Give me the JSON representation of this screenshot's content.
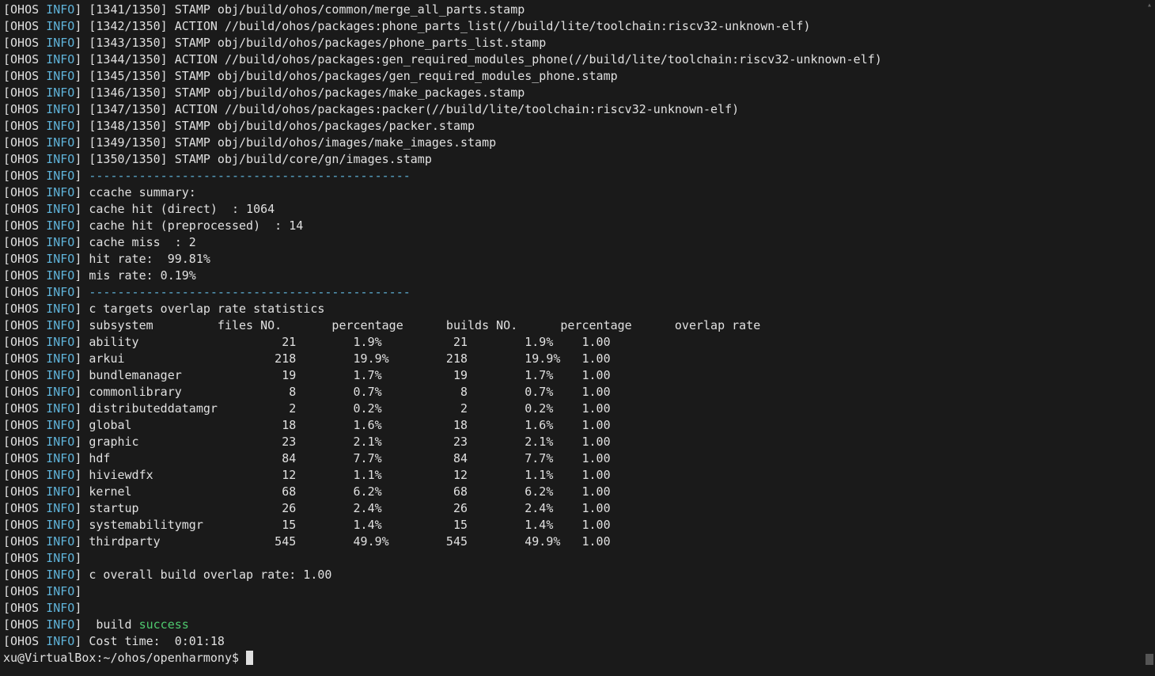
{
  "prefix_ohos": "OHOS",
  "prefix_info": "INFO",
  "build_lines": [
    {
      "counter": "[1341/1350]",
      "text": "STAMP obj/build/ohos/common/merge_all_parts.stamp"
    },
    {
      "counter": "[1342/1350]",
      "text": "ACTION //build/ohos/packages:phone_parts_list(//build/lite/toolchain:riscv32-unknown-elf)"
    },
    {
      "counter": "[1343/1350]",
      "text": "STAMP obj/build/ohos/packages/phone_parts_list.stamp"
    },
    {
      "counter": "[1344/1350]",
      "text": "ACTION //build/ohos/packages:gen_required_modules_phone(//build/lite/toolchain:riscv32-unknown-elf)"
    },
    {
      "counter": "[1345/1350]",
      "text": "STAMP obj/build/ohos/packages/gen_required_modules_phone.stamp"
    },
    {
      "counter": "[1346/1350]",
      "text": "STAMP obj/build/ohos/packages/make_packages.stamp"
    },
    {
      "counter": "[1347/1350]",
      "text": "ACTION //build/ohos/packages:packer(//build/lite/toolchain:riscv32-unknown-elf)"
    },
    {
      "counter": "[1348/1350]",
      "text": "STAMP obj/build/ohos/packages/packer.stamp"
    },
    {
      "counter": "[1349/1350]",
      "text": "STAMP obj/build/ohos/images/make_images.stamp"
    },
    {
      "counter": "[1350/1350]",
      "text": "STAMP obj/build/core/gn/images.stamp"
    }
  ],
  "divider": "---------------------------------------------",
  "ccache": {
    "summary_label": "ccache summary:",
    "hit_direct": "cache hit (direct)  : 1064",
    "hit_pre": "cache hit (preprocessed)  : 14",
    "miss": "cache miss  : 2",
    "hit_rate": "hit rate:  99.81%",
    "mis_rate": "mis rate: 0.19%"
  },
  "stats_title": "c targets overlap rate statistics",
  "stats_header": "subsystem         files NO.       percentage      builds NO.      percentage      overlap rate",
  "stats_rows": [
    {
      "subsystem": "ability",
      "files": 21,
      "fp": "1.9%",
      "builds": 21,
      "bp": "1.9%",
      "rate": "1.00"
    },
    {
      "subsystem": "arkui",
      "files": 218,
      "fp": "19.9%",
      "builds": 218,
      "bp": "19.9%",
      "rate": "1.00"
    },
    {
      "subsystem": "bundlemanager",
      "files": 19,
      "fp": "1.7%",
      "builds": 19,
      "bp": "1.7%",
      "rate": "1.00"
    },
    {
      "subsystem": "commonlibrary",
      "files": 8,
      "fp": "0.7%",
      "builds": 8,
      "bp": "0.7%",
      "rate": "1.00"
    },
    {
      "subsystem": "distributeddatamgr",
      "files": 2,
      "fp": "0.2%",
      "builds": 2,
      "bp": "0.2%",
      "rate": "1.00"
    },
    {
      "subsystem": "global",
      "files": 18,
      "fp": "1.6%",
      "builds": 18,
      "bp": "1.6%",
      "rate": "1.00"
    },
    {
      "subsystem": "graphic",
      "files": 23,
      "fp": "2.1%",
      "builds": 23,
      "bp": "2.1%",
      "rate": "1.00"
    },
    {
      "subsystem": "hdf",
      "files": 84,
      "fp": "7.7%",
      "builds": 84,
      "bp": "7.7%",
      "rate": "1.00"
    },
    {
      "subsystem": "hiviewdfx",
      "files": 12,
      "fp": "1.1%",
      "builds": 12,
      "bp": "1.1%",
      "rate": "1.00"
    },
    {
      "subsystem": "kernel",
      "files": 68,
      "fp": "6.2%",
      "builds": 68,
      "bp": "6.2%",
      "rate": "1.00"
    },
    {
      "subsystem": "startup",
      "files": 26,
      "fp": "2.4%",
      "builds": 26,
      "bp": "2.4%",
      "rate": "1.00"
    },
    {
      "subsystem": "systemabilitymgr",
      "files": 15,
      "fp": "1.4%",
      "builds": 15,
      "bp": "1.4%",
      "rate": "1.00"
    },
    {
      "subsystem": "thirdparty",
      "files": 545,
      "fp": "49.9%",
      "builds": 545,
      "bp": "49.9%",
      "rate": "1.00"
    }
  ],
  "overall_rate": "c overall build overlap rate: 1.00",
  "build_label": " build ",
  "build_status": "success",
  "cost_time": "Cost time:  0:01:18",
  "prompt": "xu@VirtualBox:~/ohos/openharmony$ "
}
